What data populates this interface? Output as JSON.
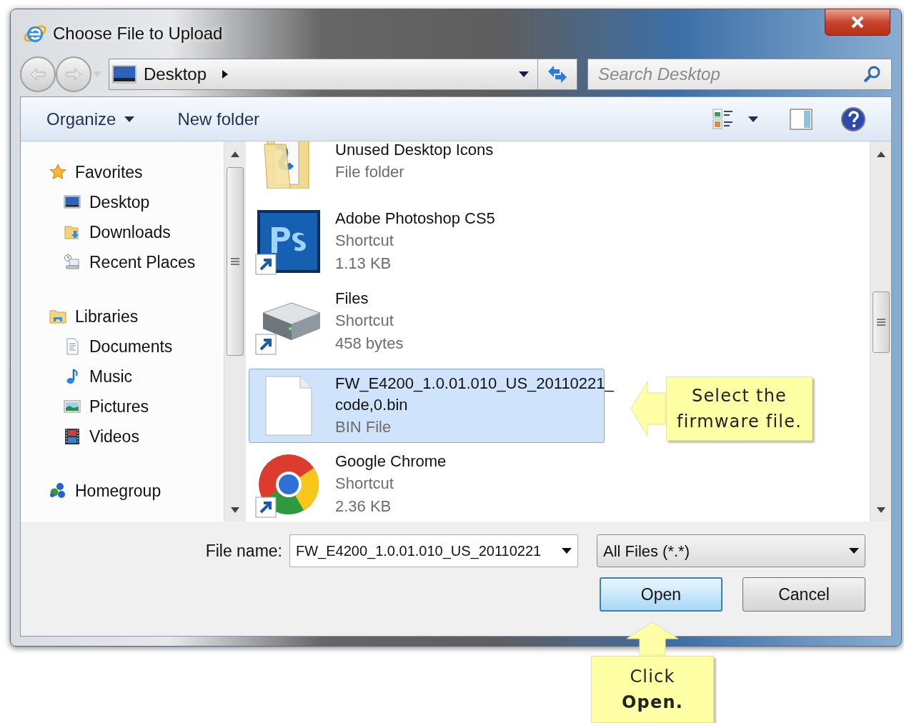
{
  "window": {
    "title": "Choose File to Upload"
  },
  "address_bar": {
    "location": "Desktop"
  },
  "search": {
    "placeholder": "Search Desktop"
  },
  "toolbar": {
    "organize": "Organize",
    "new_folder": "New folder"
  },
  "navigation": [
    {
      "label": "Favorites",
      "kind": "star",
      "children": [
        {
          "label": "Desktop",
          "kind": "desktop"
        },
        {
          "label": "Downloads",
          "kind": "downloads"
        },
        {
          "label": "Recent Places",
          "kind": "recent"
        }
      ]
    },
    {
      "label": "Libraries",
      "kind": "library",
      "children": [
        {
          "label": "Documents",
          "kind": "documents"
        },
        {
          "label": "Music",
          "kind": "music"
        },
        {
          "label": "Pictures",
          "kind": "pictures"
        },
        {
          "label": "Videos",
          "kind": "videos"
        }
      ]
    },
    {
      "label": "Homegroup",
      "kind": "homegroup"
    }
  ],
  "files": [
    {
      "name_lines": [
        "Unused Desktop Icons"
      ],
      "details": [
        "File folder"
      ],
      "kind": "folder",
      "shortcut": false,
      "selected": false
    },
    {
      "name_lines": [
        "Adobe Photoshop CS5"
      ],
      "details": [
        "Shortcut",
        "1.13 KB"
      ],
      "kind": "photoshop",
      "shortcut": true,
      "selected": false
    },
    {
      "name_lines": [
        "Files"
      ],
      "details": [
        "Shortcut",
        "458 bytes"
      ],
      "kind": "drive",
      "shortcut": true,
      "selected": false
    },
    {
      "name_lines": [
        "FW_E4200_1.0.01.010_US_20110221_",
        "code,0.bin"
      ],
      "details": [
        "BIN File"
      ],
      "kind": "blank",
      "shortcut": false,
      "selected": true
    },
    {
      "name_lines": [
        "Google Chrome"
      ],
      "details": [
        "Shortcut",
        "2.36 KB"
      ],
      "kind": "chrome",
      "shortcut": true,
      "selected": false
    }
  ],
  "file_name": {
    "label": "File name:",
    "value": "FW_E4200_1.0.01.010_US_20110221"
  },
  "file_type": {
    "value": "All Files (*.*)"
  },
  "buttons": [
    {
      "label": "Open",
      "kind": "default"
    },
    {
      "label": "Cancel",
      "kind": "normal"
    }
  ],
  "callouts": [
    {
      "lines": [
        "Select the",
        "firmware file."
      ],
      "kind": "left"
    },
    {
      "lines": [
        "Click",
        "**Open.**"
      ],
      "kind": "up"
    }
  ]
}
